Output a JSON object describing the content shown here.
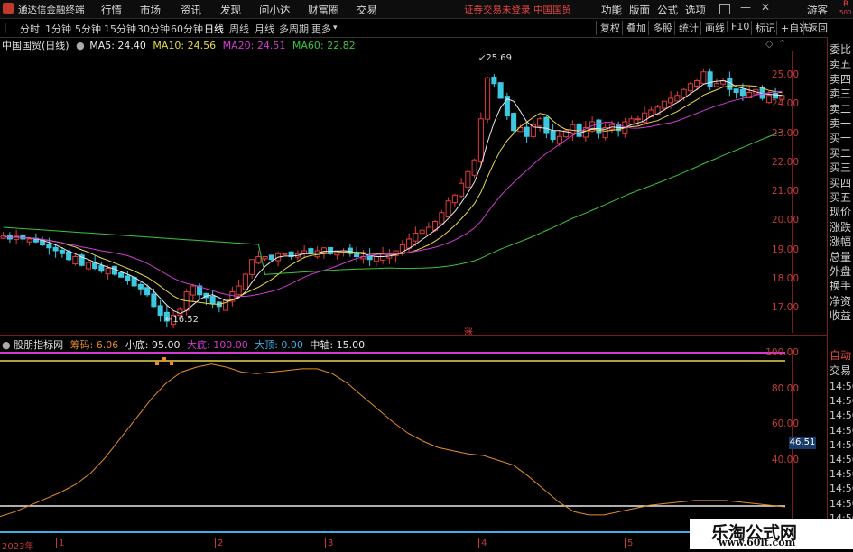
{
  "app": {
    "title": "通达信金融终端",
    "menu": [
      "行情",
      "市场",
      "资讯",
      "发现",
      "问小达",
      "财富圈",
      "交易"
    ],
    "notice": "证券交易未登录",
    "stock_name_top": "中国国贸",
    "right_menu": [
      "功能",
      "版面",
      "公式",
      "选项"
    ],
    "guest": "游客",
    "r_badge": "R",
    "r_badge_num": "500"
  },
  "toolbar": {
    "periods": [
      "分时",
      "1分钟",
      "5分钟",
      "15分钟",
      "30分钟",
      "60分钟",
      "日线",
      "周线",
      "月线",
      "多周期",
      "更多"
    ],
    "active_period": "日线",
    "right_buttons": [
      "复权",
      "叠加",
      "多股",
      "统计",
      "画线",
      "F10",
      "标记",
      "+自选",
      "返回"
    ]
  },
  "main_chart": {
    "stock_label": "中国国贸(日线)",
    "ma": [
      {
        "label": "MA5: 24.40",
        "color": "#e8e8e8"
      },
      {
        "label": "MA10: 24.56",
        "color": "#e6d94a"
      },
      {
        "label": "MA20: 24.51",
        "color": "#d23bd2"
      },
      {
        "label": "MA60: 22.82",
        "color": "#3cc43c"
      }
    ],
    "y_ticks": [
      "25.00",
      "24.00",
      "23.00",
      "22.00",
      "21.00",
      "20.00",
      "19.00",
      "18.00",
      "17.00"
    ],
    "high_marker": "25.69",
    "low_marker": "16.52",
    "zhang_tag": "涨"
  },
  "indicator": {
    "name": "股朋指标网",
    "items": [
      {
        "label": "筹码: 6.06",
        "color": "#e88b2b"
      },
      {
        "label": "小底: 95.00",
        "color": "#e8e8e8"
      },
      {
        "label": "大底: 100.00",
        "color": "#d23bd2"
      },
      {
        "label": "大顶: 0.00",
        "color": "#3bb0e6"
      },
      {
        "label": "中轴: 15.00",
        "color": "#e8e8e8"
      }
    ],
    "y_ticks": [
      "100.00",
      "80.00",
      "60.00",
      "40.00"
    ],
    "current_value": "46.51"
  },
  "time_axis": [
    "2023年",
    "1",
    "2",
    "3",
    "4",
    "5"
  ],
  "right_panel": {
    "upper": [
      "委比",
      "卖五",
      "卖四",
      "卖三",
      "卖二",
      "卖一",
      "买一",
      "买二",
      "买三",
      "买四",
      "买五",
      "现价",
      "涨跌",
      "涨幅",
      "总量",
      "外盘",
      "换手",
      "净资",
      "收益"
    ],
    "lower_head": [
      "自动",
      "交易"
    ],
    "times": [
      "14:56",
      "14:56",
      "14:56",
      "14:56",
      "14:56",
      "14:56",
      "14:56",
      "14:56",
      "14:56",
      "14:56",
      "14:5"
    ]
  },
  "watermark": {
    "title": "乐淘公式网",
    "url": "www.60lt.com"
  },
  "chart_data": {
    "type": "candlestick",
    "ylim": [
      16.3,
      25.9
    ],
    "x": [
      "2023年",
      "1",
      "2",
      "3",
      "4",
      "5"
    ],
    "close_series": [
      19.6,
      19.5,
      19.6,
      19.5,
      19.5,
      19.4,
      19.3,
      19.2,
      19.1,
      19.0,
      18.8,
      18.9,
      18.6,
      18.7,
      18.5,
      18.4,
      18.5,
      18.3,
      18.2,
      18.1,
      17.9,
      17.8,
      17.6,
      17.2,
      16.9,
      16.7,
      16.9,
      17.1,
      17.7,
      17.9,
      17.6,
      17.5,
      17.3,
      17.2,
      17.4,
      17.7,
      17.9,
      18.3,
      18.8,
      18.9,
      18.9,
      18.8,
      19.0,
      19.0,
      18.9,
      19.0,
      19.1,
      19.0,
      19.1,
      19.2,
      19.0,
      19.1,
      19.1,
      19.0,
      18.9,
      18.9,
      18.8,
      18.9,
      19.0,
      19.0,
      19.1,
      19.3,
      19.5,
      19.7,
      19.8,
      19.9,
      20.1,
      20.4,
      20.8,
      21.0,
      21.4,
      21.8,
      22.2,
      23.6,
      25.0,
      24.8,
      24.3,
      23.7,
      23.2,
      23.3,
      23.0,
      23.4,
      23.6,
      23.1,
      22.9,
      23.0,
      23.2,
      23.4,
      23.0,
      23.3,
      23.5,
      23.1,
      23.3,
      23.4,
      23.2,
      23.5,
      23.6,
      23.6,
      23.8,
      23.9,
      24.0,
      24.2,
      24.3,
      24.4,
      24.6,
      24.8,
      24.9,
      25.2,
      24.7,
      24.8,
      24.9,
      24.6,
      24.5,
      24.4,
      24.5,
      24.6,
      24.3,
      24.4,
      24.3,
      24.4
    ],
    "indicator_series": [
      3,
      6,
      10,
      14,
      18,
      23,
      30,
      40,
      52,
      64,
      76,
      86,
      93,
      96,
      98,
      96,
      93,
      92,
      93,
      94,
      95,
      95,
      92,
      86,
      78,
      70,
      62,
      55,
      50,
      46,
      44,
      42,
      41,
      38,
      35,
      28,
      20,
      12,
      6,
      4,
      4,
      6,
      8,
      10,
      11,
      12,
      13,
      13,
      13,
      12,
      11,
      10,
      9
    ]
  }
}
